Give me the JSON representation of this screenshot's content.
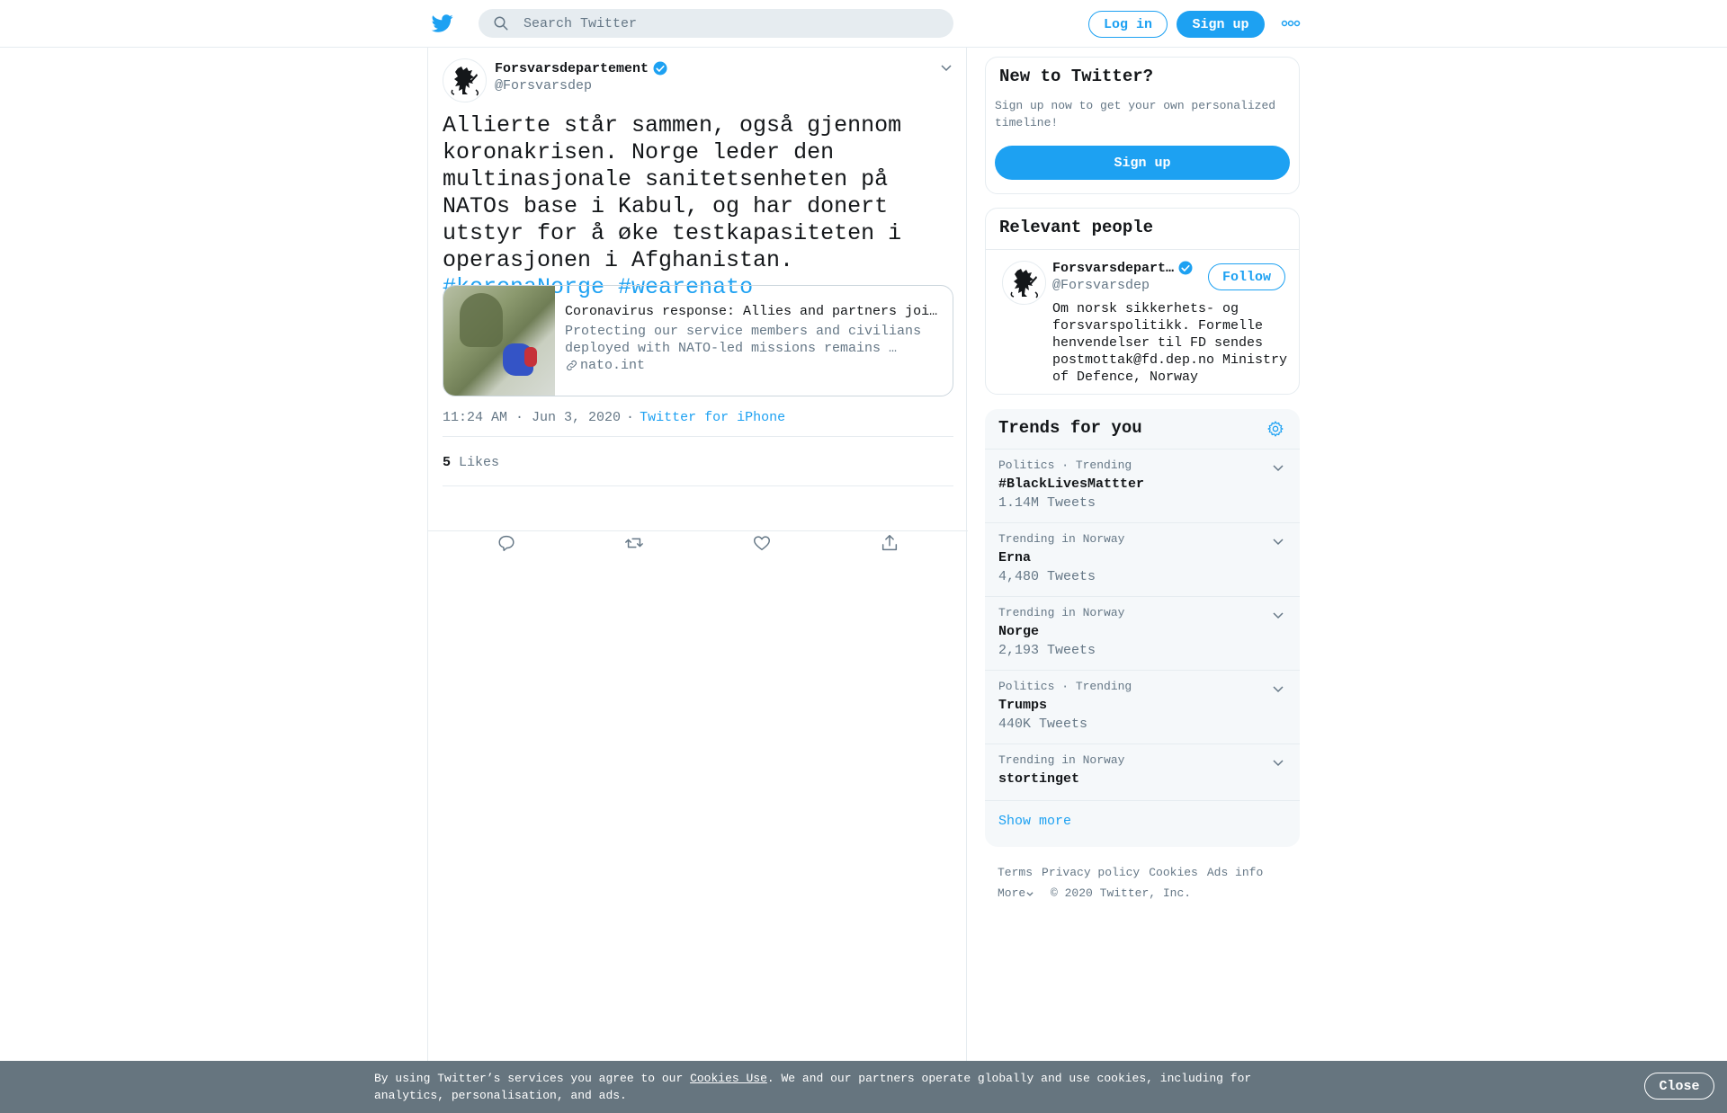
{
  "header": {
    "search_placeholder": "Search Twitter",
    "login_label": "Log in",
    "signup_label": "Sign up"
  },
  "tweet": {
    "author_name": "Forsvarsdepartement",
    "author_handle": "@Forsvarsdep",
    "text": "Allierte står sammen, også gjennom koronakrisen. Norge leder den multinasjonale sanitetsenheten på NATOs base i Kabul, og har donert utstyr for å øke testkapasiteten i operasjonen i Afghanistan.",
    "hashtags": [
      "#koronaNorge",
      "#wearenato"
    ],
    "card": {
      "title": "Coronavirus response: Allies and partners joi…",
      "description": "Protecting our service members and civilians deployed with NATO-led missions remains …",
      "domain": "nato.int"
    },
    "time": "11:24 AM · Jun 3, 2020",
    "separator": "·",
    "source": "Twitter for iPhone",
    "likes_count": "5",
    "likes_label": "Likes"
  },
  "sidebar": {
    "new_to_twitter": {
      "title": "New to Twitter?",
      "description": "Sign up now to get your own personalized timeline!",
      "button": "Sign up"
    },
    "relevant_people": {
      "title": "Relevant people",
      "name": "Forsvarsdepart…",
      "handle": "@Forsvarsdep",
      "follow_label": "Follow",
      "bio": "Om norsk sikkerhets- og forsvarspolitikk. Formelle henvendelser til FD sendes postmottak@fd.dep.no Ministry of Defence, Norway"
    },
    "trends": {
      "title": "Trends for you",
      "items": [
        {
          "context": "Politics · Trending",
          "name": "#BlackLivesMattter",
          "count": "1.14M Tweets"
        },
        {
          "context": "Trending in Norway",
          "name": "Erna",
          "count": "4,480 Tweets"
        },
        {
          "context": "Trending in Norway",
          "name": "Norge",
          "count": "2,193 Tweets"
        },
        {
          "context": "Politics · Trending",
          "name": "Trumps",
          "count": "440K Tweets"
        },
        {
          "context": "Trending in Norway",
          "name": "stortinget",
          "count": ""
        }
      ],
      "show_more": "Show more"
    },
    "footer": {
      "links": [
        "Terms",
        "Privacy policy",
        "Cookies",
        "Ads info",
        "More"
      ],
      "copyright": "© 2020 Twitter, Inc."
    }
  },
  "cookie_banner": {
    "text_before": "By using Twitter’s services you agree to our ",
    "link": "Cookies Use",
    "text_after": ". We and our partners operate globally and use cookies, including for analytics, personalisation, and ads.",
    "close_label": "Close"
  },
  "colors": {
    "brand": "#1da1f2",
    "text": "#14171a",
    "secondary": "#657786",
    "banner": "#66757f"
  }
}
